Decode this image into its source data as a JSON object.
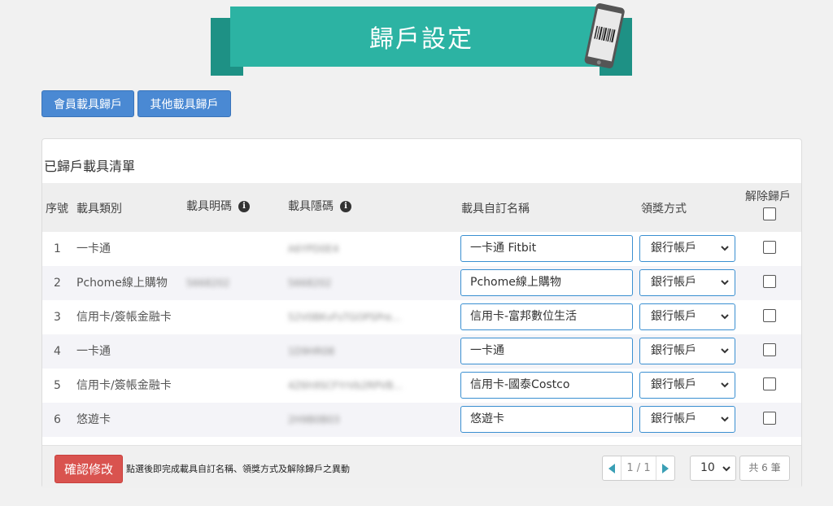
{
  "banner": {
    "title": "歸戶設定"
  },
  "top_buttons": {
    "member": "會員載具歸戶",
    "other": "其他載具歸戶"
  },
  "panel": {
    "title": "已歸戶載具清單",
    "headers": {
      "seq": "序號",
      "type": "載具類別",
      "visible_code": "載具明碼",
      "hidden_code": "載具隱碼",
      "custom_name": "載具自訂名稱",
      "award": "領獎方式",
      "unlink": "解除歸戶"
    },
    "rows": [
      {
        "seq": "1",
        "type": "一卡通",
        "visible_code": "",
        "hidden_code": "A6YPD0E4",
        "custom_name": "一卡通 Fitbit",
        "award": "銀行帳戶"
      },
      {
        "seq": "2",
        "type": "Pchome線上購物",
        "visible_code": "5668202",
        "hidden_code": "5668202",
        "custom_name": "Pchome線上購物",
        "award": "銀行帳戶"
      },
      {
        "seq": "3",
        "type": "信用卡/簽帳金融卡",
        "visible_code": "",
        "hidden_code": "52V0BKvFsTGOPSPre...",
        "custom_name": "信用卡-富邦數位生活",
        "award": "銀行帳戶"
      },
      {
        "seq": "4",
        "type": "一卡通",
        "visible_code": "",
        "hidden_code": "1D9HR08",
        "custom_name": "一卡通",
        "award": "銀行帳戶"
      },
      {
        "seq": "5",
        "type": "信用卡/簽帳金融卡",
        "visible_code": "",
        "hidden_code": "4Z6h9SCFYrVb2RPVB...",
        "custom_name": "信用卡-國泰Costco",
        "award": "銀行帳戶"
      },
      {
        "seq": "6",
        "type": "悠遊卡",
        "visible_code": "",
        "hidden_code": "2H9B0B03",
        "custom_name": "悠遊卡",
        "award": "銀行帳戶"
      }
    ]
  },
  "footer": {
    "confirm_label": "確認修改",
    "confirm_hint": "點選後即完成載具自訂名稱、領獎方式及解除歸戶之異動",
    "page_indicator": "1 / 1",
    "per_page": "10",
    "total": "共 6 筆"
  },
  "colors": {
    "banner_main": "#2cb3a3",
    "banner_dark": "#1e9185",
    "primary_button": "#4a89d3",
    "danger_button": "#d9534f",
    "input_border": "#3a8fd1",
    "pager_arrow": "#3a9fb5"
  },
  "icons": {
    "info": "info-circle-icon",
    "phone": "phone-barcode-icon",
    "select_arrow": "chevron-down-icon",
    "prev": "triangle-left-icon",
    "next": "triangle-right-icon"
  }
}
